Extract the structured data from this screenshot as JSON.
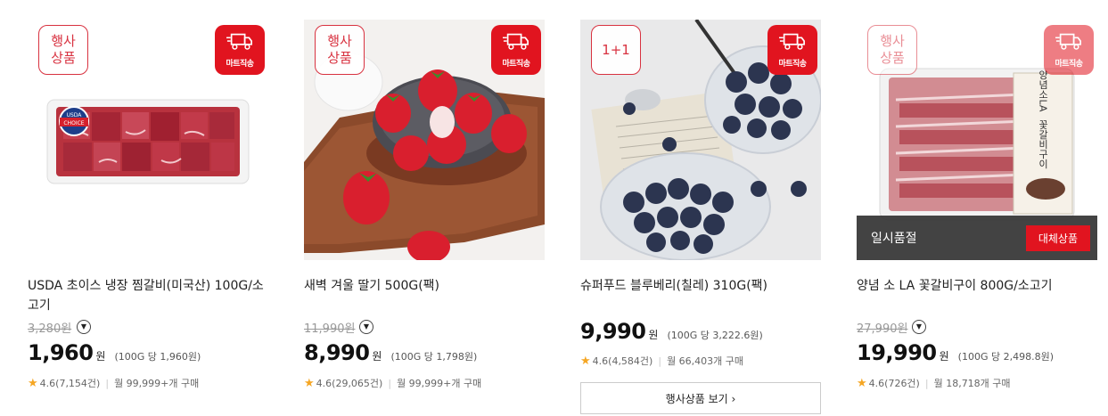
{
  "products": [
    {
      "promo_badge": "행사\n상품",
      "ship_badge": "마트직송",
      "title": "USDA 초이스 냉장 찜갈비(미국산) 100G/소고기",
      "original_price": "3,280원",
      "price": "1,960",
      "currency": "원",
      "unit_price": "(100G 당 1,960원)",
      "rating": "4.6(7,154건)",
      "sold": "월 99,999+개 구매",
      "image_logo_text": "USDA CHOICE"
    },
    {
      "promo_badge": "행사\n상품",
      "ship_badge": "마트직송",
      "title": "새벽 겨울 딸기 500G(팩)",
      "original_price": "11,990원",
      "price": "8,990",
      "currency": "원",
      "unit_price": "(100G 당 1,798원)",
      "rating": "4.6(29,065건)",
      "sold": "월 99,999+개 구매"
    },
    {
      "promo_badge": "1+1",
      "ship_badge": "마트직송",
      "title": "슈퍼푸드 블루베리(칠레) 310G(팩)",
      "price": "9,990",
      "currency": "원",
      "unit_price": "(100G 당 3,222.6원)",
      "rating": "4.6(4,584건)",
      "sold": "월 66,403개 구매",
      "view_button": "행사상품 보기 ›"
    },
    {
      "promo_badge": "행사\n상품",
      "ship_badge": "마트직송",
      "title": "양념 소 LA 꽃갈비구이 800G/소고기",
      "original_price": "27,990원",
      "price": "19,990",
      "currency": "원",
      "unit_price": "(100G 당 2,498.8원)",
      "rating": "4.6(726건)",
      "sold": "월 18,718개 구매",
      "soldout_label": "일시품절",
      "substitute_button": "대체상품",
      "package_text": "양념소LA 꽃갈비구이"
    }
  ],
  "icons": {
    "star": "star-icon",
    "truck": "truck-icon",
    "chevron": "chevron-down-icon"
  },
  "colors": {
    "accent": "#e1141f",
    "promo": "#d83240",
    "star": "#f5a623"
  }
}
